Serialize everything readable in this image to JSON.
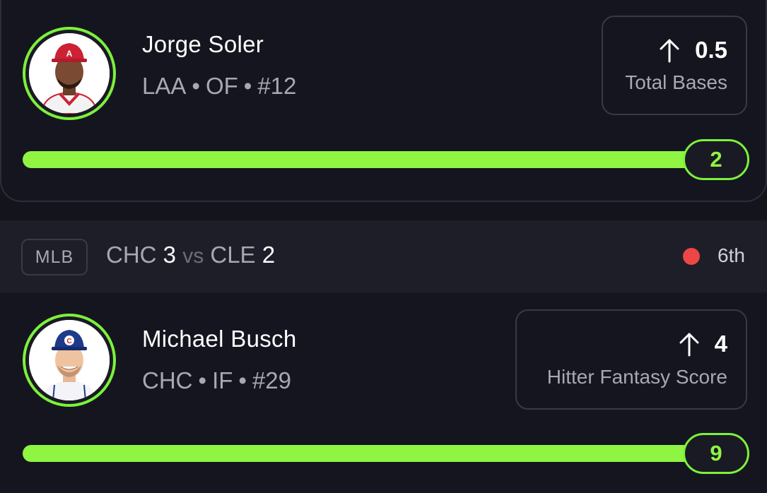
{
  "players": [
    {
      "name": "Jorge Soler",
      "team": "LAA",
      "position": "OF",
      "number": "#12",
      "stat_value": "0.5",
      "stat_label": "Total Bases",
      "direction_icon": "arrow-up-icon",
      "progress_value": "2",
      "progress_fraction": 1.0,
      "accent_color": "#7cf23a"
    },
    {
      "name": "Michael Busch",
      "team": "CHC",
      "position": "IF",
      "number": "#29",
      "stat_value": "4",
      "stat_label": "Hitter Fantasy Score",
      "direction_icon": "arrow-up-icon",
      "progress_value": "9",
      "progress_fraction": 1.0,
      "accent_color": "#7cf23a"
    }
  ],
  "game": {
    "league": "MLB",
    "away_team": "CHC",
    "away_score": "3",
    "vs": "vs",
    "home_team": "CLE",
    "home_score": "2",
    "inning": "6th",
    "live_color": "#ee4545"
  }
}
